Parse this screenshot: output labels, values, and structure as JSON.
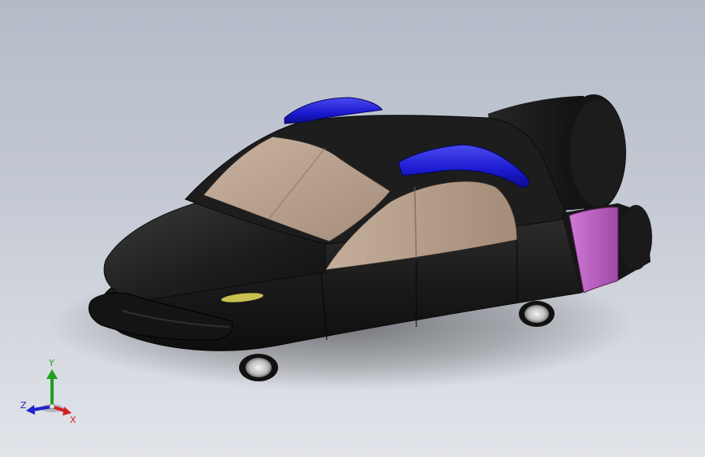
{
  "viewport": {
    "background_top": "#b4bbc8",
    "background_bottom": "#e2e4ea"
  },
  "model": {
    "body_color": "#1b1b1b",
    "glass_color": "#b59e89",
    "accent_blue": "#1a1ad6",
    "accent_magenta": "#c060c8",
    "headlight_color": "#c8c050"
  },
  "triad": {
    "x_label": "X",
    "y_label": "Y",
    "z_label": "Z",
    "x_color": "#d42020",
    "y_color": "#20a020",
    "z_color": "#2020c8"
  }
}
